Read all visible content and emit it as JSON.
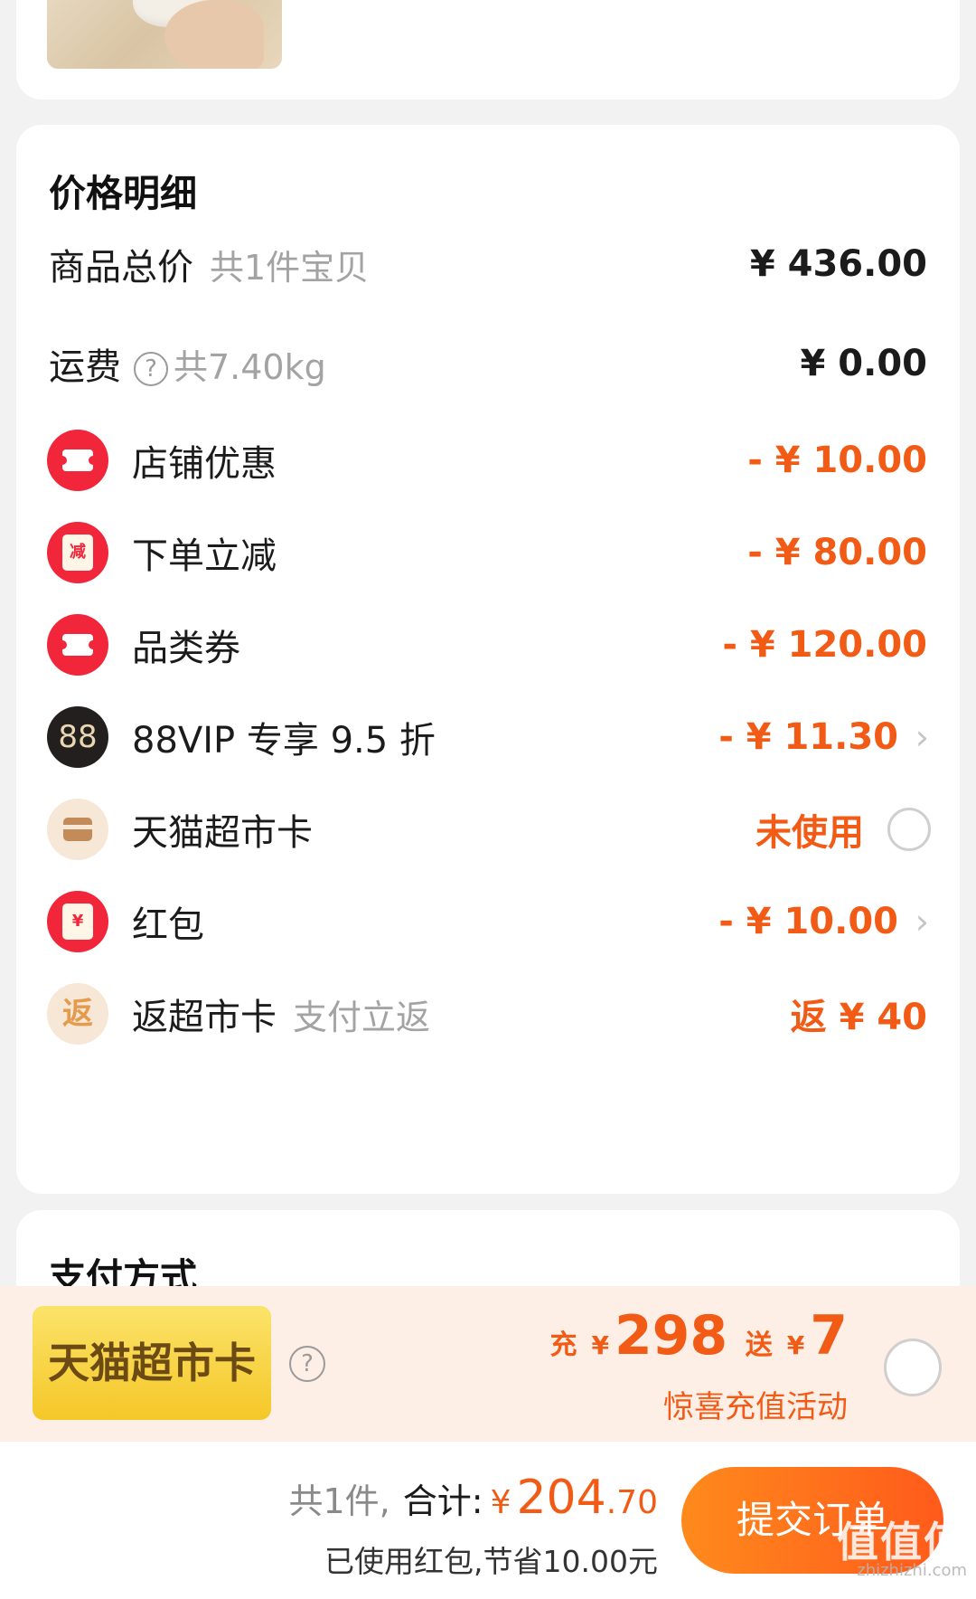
{
  "price_details": {
    "title": "价格明细",
    "total": {
      "label": "商品总价",
      "sub": "共1件宝贝",
      "value": "¥ 436.00"
    },
    "shipping": {
      "label": "运费",
      "help": "?",
      "sub": "共7.40kg",
      "value": "¥ 0.00"
    },
    "items": [
      {
        "label": "店铺优惠",
        "value": "- ¥ 10.00",
        "icon": "ticket-icon"
      },
      {
        "label": "下单立减",
        "value": "- ¥ 80.00",
        "icon": "discount-box-icon",
        "glyph": "减"
      },
      {
        "label": "品类券",
        "value": "- ¥ 120.00",
        "icon": "ticket-icon"
      },
      {
        "label": "88VIP 专享 9.5 折",
        "value": "- ¥ 11.30",
        "icon": "vip88-icon",
        "glyph": "88",
        "chevron": "›"
      },
      {
        "label": "天猫超市卡",
        "value": "未使用",
        "icon": "card-icon"
      },
      {
        "label": "红包",
        "value": "- ¥ 10.00",
        "icon": "red-packet-icon",
        "glyph": "¥",
        "chevron": "›"
      },
      {
        "label": "返超市卡",
        "sub": "支付立返",
        "value": "返 ¥ 40",
        "icon": "rebate-icon",
        "glyph": "返"
      }
    ]
  },
  "payment": {
    "title": "支付方式"
  },
  "promo": {
    "badge": "天猫超市卡",
    "help": "?",
    "charge_label": "充",
    "currency": "¥",
    "charge_amount": "298",
    "bonus_label": "送",
    "bonus_amount": "7",
    "subtitle": "惊喜充值活动"
  },
  "footer": {
    "qty": "共1件,",
    "total_label": "合计:",
    "currency": "¥",
    "total_int": "204",
    "total_dec": ".70",
    "saved": "已使用红包,节省10.00元",
    "submit": "提交订单",
    "watermark": "值值值",
    "watermark_url": "zhizhizhi.com"
  },
  "colors": {
    "accent": "#f25b16",
    "red_icon": "#f2263a",
    "submit_start": "#ff8a1c",
    "submit_end": "#ff5a1b",
    "badge_gold": "#f5c728"
  }
}
